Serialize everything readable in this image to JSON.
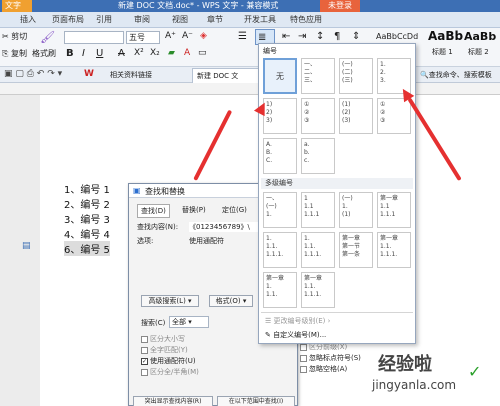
{
  "titlebar": {
    "app": "文字",
    "title": "新建 DOC 文档.doc* - WPS 文字 - 兼容模式",
    "login": "未登录"
  },
  "tabs": [
    "插入",
    "页面布局",
    "引用",
    "审阅",
    "视图",
    "章节",
    "开发工具",
    "特色应用"
  ],
  "ribbon": {
    "cut": "剪切",
    "copy": "复制",
    "format_painter": "格式刷",
    "font_size": "五号",
    "bold": "B",
    "italic": "I",
    "underline": "U",
    "strike": "A",
    "sup": "X²",
    "sub": "X₂",
    "style1": "AaBbCcDd",
    "style2": "AaBb",
    "style3": "AaBb",
    "style2_name": "标题 1",
    "style3_name": "标题 2",
    "find_cmd": "查找命令、搜索模板"
  },
  "docbar": {
    "tab1": "相关资料链接",
    "tab2": "新建 DOC 文"
  },
  "document": {
    "lines": [
      "1、编号 1",
      "2、编号 2",
      "3、编号 3",
      "4、编号 4",
      "5、编号 5",
      "6、编号 5"
    ]
  },
  "dialog": {
    "title": "查找和替换",
    "tabs": [
      "查找(D)",
      "替换(P)",
      "定位(G)"
    ],
    "find_label": "查找内容(N):",
    "find_value": "《012345678​9》\\",
    "options_label": "选项:",
    "options_value": "使用通配符",
    "advanced_btn": "高级搜索(L)",
    "format_btn": "格式(O)",
    "search_label": "搜索(C)",
    "search_value": "全部",
    "checks": [
      "区分大小写",
      "全字匹配(Y)",
      "使用通配符(U)",
      "区分全/半角(M)"
    ],
    "checks_right": [
      "区分前缀(X)",
      "区分后缀(T)",
      "忽略标点符号(S)",
      "忽略空格(A)"
    ],
    "bottom_btns": [
      "突出显示查找内容(R)",
      "在以下范围中查找(I)"
    ]
  },
  "dropdown": {
    "header": "编号",
    "none": "无",
    "cells_row1": [
      [
        "一、",
        "二、",
        "三、"
      ],
      [
        "(一)",
        "(二)",
        "(三)"
      ],
      [
        "1.",
        "2.",
        "3."
      ]
    ],
    "cells_row2": [
      [
        "1)",
        "2)",
        "3)"
      ],
      [
        "①",
        "②",
        "③"
      ],
      [
        "(1)",
        "(2)",
        "(3)"
      ],
      [
        "①",
        "②",
        "③"
      ]
    ],
    "cells_row3": [
      [
        "A.",
        "B.",
        "C."
      ],
      [
        "a.",
        "b.",
        "c."
      ]
    ],
    "multi_header": "多级编号",
    "ml_row1": [
      [
        "一、",
        "(一)",
        "1."
      ],
      [
        "1",
        "1.1",
        "1.1.1"
      ],
      [
        "(一)",
        "1.",
        "(1)"
      ],
      [
        "第一章",
        "1.1",
        "1.1.1"
      ]
    ],
    "ml_row2": [
      [
        "1.",
        "1.1.",
        "1.1.1."
      ],
      [
        "1.",
        "1.1.",
        "1.1.1."
      ],
      [
        "第一章",
        "第一节",
        "第一条"
      ],
      [
        "第一章",
        "1.1.",
        "1.1.1."
      ]
    ],
    "ml_row3": [
      [
        "第一章",
        "1.",
        "1.1."
      ],
      [
        "第一章",
        "1.1.",
        "1.1.1."
      ]
    ],
    "change_level": "更改编号级别(E)",
    "custom": "自定义编号(M)..."
  },
  "watermark": {
    "text": "经验啦",
    "url": "jingyanla.com"
  },
  "colors": {
    "accent": "#3d6fb4",
    "arrow": "#e53030",
    "login": "#e8633c"
  }
}
